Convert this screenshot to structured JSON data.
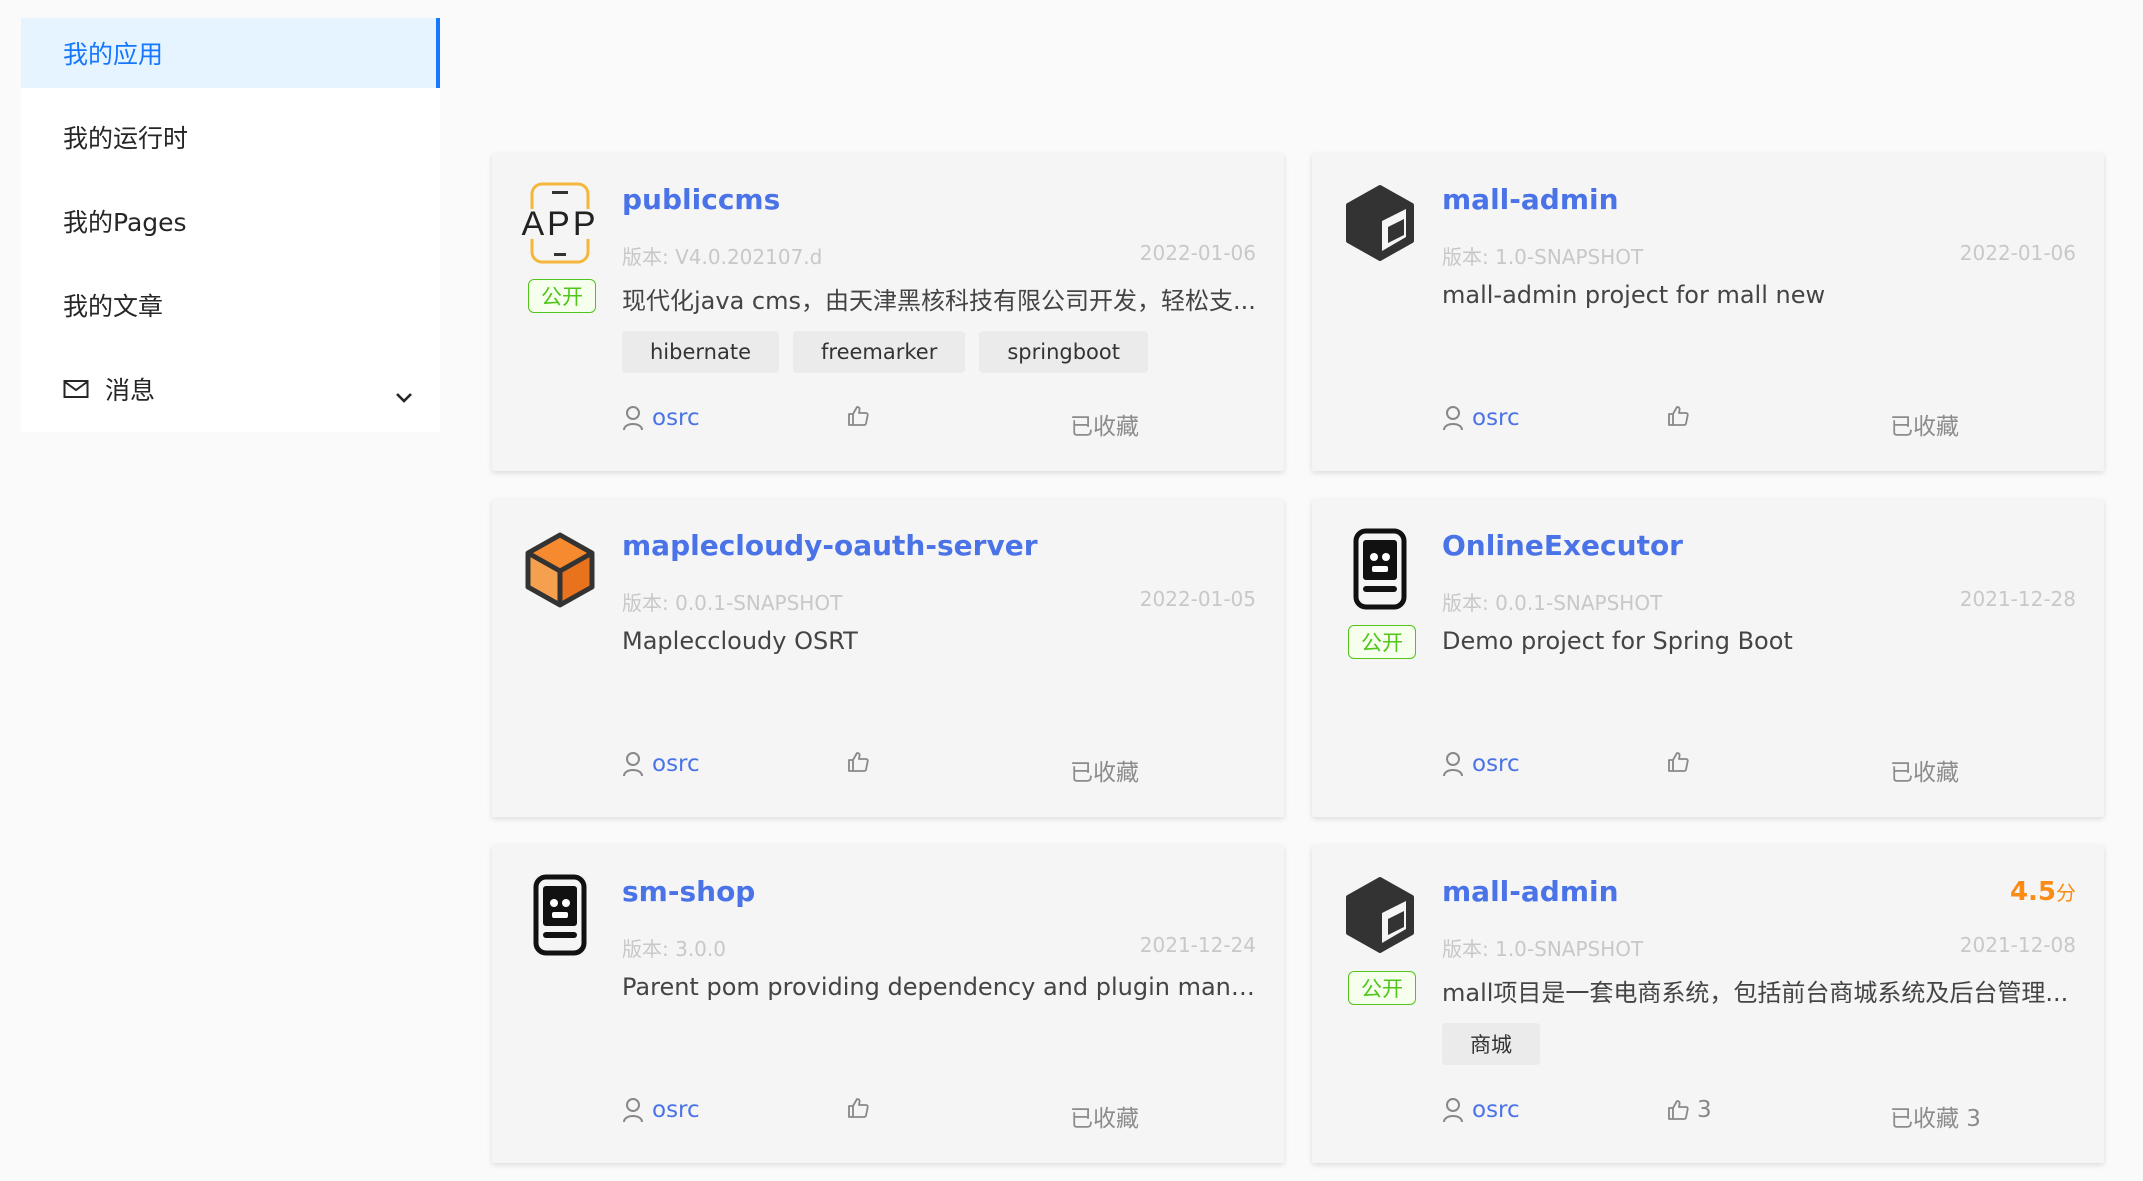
{
  "sidebar": {
    "items": [
      {
        "label": "我的应用",
        "active": true
      },
      {
        "label": "我的运行时"
      },
      {
        "label": "我的Pages"
      },
      {
        "label": "我的文章"
      },
      {
        "label": "消息",
        "icon": "mail-icon",
        "expandable": true
      }
    ]
  },
  "colors": {
    "accent": "#1677ff",
    "title": "#4a73e8",
    "public": "#52c41a",
    "score": "#fa8c16"
  },
  "cards": [
    {
      "logo": "app-text-logo",
      "title": "publiccms",
      "version": "版本: V4.0.202107.d",
      "date": "2022-01-06",
      "public_badge": "公开",
      "desc": "现代化java cms，由天津黑核科技有限公司开发，轻松支...",
      "tags": [
        "hibernate",
        "freemarker",
        "springboot"
      ],
      "author": "osrc",
      "likes": "",
      "fav": "已收藏"
    },
    {
      "logo": "dark-cube-logo",
      "title": "mall-admin",
      "version": "版本: 1.0-SNAPSHOT",
      "date": "2022-01-06",
      "desc": "mall-admin project for mall new",
      "tags": [],
      "author": "osrc",
      "likes": "",
      "fav": "已收藏"
    },
    {
      "logo": "orange-cube-logo",
      "title": "maplecloudy-oauth-server",
      "version": "版本: 0.0.1-SNAPSHOT",
      "date": "2022-01-05",
      "desc": "Mapleccloudy OSRT",
      "tags": [],
      "author": "osrc",
      "likes": "",
      "fav": "已收藏"
    },
    {
      "logo": "robot-device-logo",
      "title": "OnlineExecutor",
      "version": "版本: 0.0.1-SNAPSHOT",
      "date": "2021-12-28",
      "public_badge": "公开",
      "desc": "Demo project for Spring Boot",
      "tags": [],
      "author": "osrc",
      "likes": "",
      "fav": "已收藏"
    },
    {
      "logo": "robot-device-logo",
      "title": "sm-shop",
      "version": "版本: 3.0.0",
      "date": "2021-12-24",
      "desc": "Parent pom providing dependency and plugin managem...",
      "tags": [],
      "author": "osrc",
      "likes": "",
      "fav": "已收藏"
    },
    {
      "logo": "dark-cube-logo",
      "title": "mall-admin",
      "score": "4.5",
      "score_unit": "分",
      "version": "版本: 1.0-SNAPSHOT",
      "date": "2021-12-08",
      "public_badge": "公开",
      "desc": "mall项目是一套电商系统，包括前台商城系统及后台管理...",
      "tags": [
        "商城"
      ],
      "author": "osrc",
      "likes": "3",
      "fav": "已收藏 3"
    }
  ]
}
